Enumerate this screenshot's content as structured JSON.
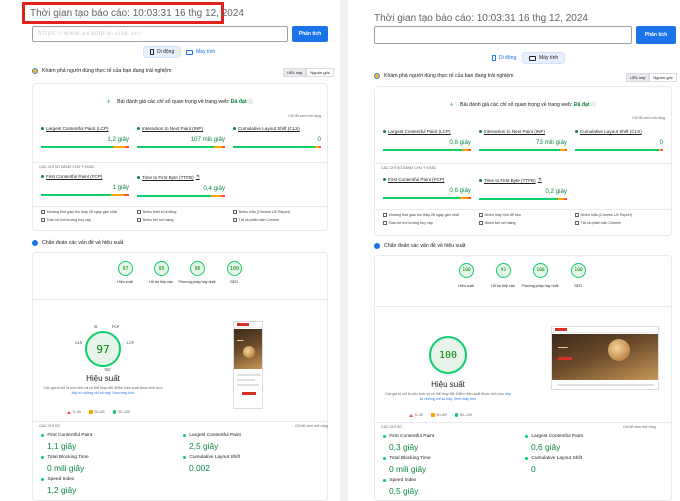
{
  "left": {
    "timestamp": "Thời gian tạo báo cáo: 10:03:31 16 thg 12, 2024",
    "url_value": "https://www.example-site.vn/",
    "analyze_label": "Phân tích",
    "tabs": {
      "mobile": "Di động",
      "desktop": "Máy tính"
    },
    "cwv": {
      "title": "Khám phá người dùng thực tế của bạn đang trải nghiệm",
      "toggle_url": "URL này",
      "toggle_origin": "Nguồn gốc",
      "assessment_prefix": "Bài đánh giá các chỉ số quan trọng về trang web:",
      "assessment_result": "Đã đạt",
      "more_info": "Chỉ đủ xem mở rộng",
      "metrics": [
        {
          "name": "Largest Contentful Paint (LCP)",
          "value": "1,2 giây"
        },
        {
          "name": "Interaction to Next Paint (INP)",
          "value": "107 mili giây"
        },
        {
          "name": "Cumulative Layout Shift (CLS)",
          "value": "0"
        }
      ],
      "other_heading": "CÁC CHỈ SỐ ĐÁNG CHÚ Ý KHÁC",
      "other_metrics": [
        {
          "name": "First Contentful Paint (FCP)",
          "value": "1 giây"
        },
        {
          "name": "Time to First Byte (TTFB)",
          "value": "0,4 giây"
        }
      ],
      "info": [
        "Khoảng thời gian thu thập 28 ngày gần nhất",
        "Nhiều thiết bị di động",
        "Nhiều mẫu (Chrome UX Report)",
        "Toàn bộ thời lượng truy cập",
        "Nhiều kết nối mạng",
        "Tất cả phiên bản Chrome"
      ],
      "info_link": "Chrome UX Report"
    },
    "diag": {
      "title": "Chẩn đoán các vấn đề về hiệu suất",
      "scores": [
        {
          "score": "97",
          "label": "Hiệu suất"
        },
        {
          "score": "95",
          "label": "Hỗ trợ tiếp cận"
        },
        {
          "score": "96",
          "label": "Phương pháp hay nhất"
        },
        {
          "score": "100",
          "label": "SEO"
        }
      ],
      "big_score": "97",
      "big_title": "Hiệu suất",
      "gauge_labels": {
        "si": "SI",
        "fcp": "FCP",
        "cls": "CLS",
        "lcp": "LCP",
        "tbt": "TBT"
      },
      "description_start": "Các giá trị chỉ là ước tính và có thể thay đổi. Điểm hiệu suất được tính trực",
      "description_link": "tiếp từ những chỉ số này.",
      "description_link2": "Xem máy tính",
      "legend": [
        "0–49",
        "50–89",
        "90–100"
      ],
      "metrics_heading": "CÁC CHỈ SỐ",
      "expand_label": "Chỉ đủ xem mở rộng",
      "metrics": [
        {
          "name": "First Contentful Paint",
          "value": "1,1 giây"
        },
        {
          "name": "Largest Contentful Paint",
          "value": "2,5 giây"
        },
        {
          "name": "Total Blocking Time",
          "value": "0 mili giây"
        },
        {
          "name": "Cumulative Layout Shift",
          "value": "0.002"
        },
        {
          "name": "Speed Index",
          "value": "1,2 giây"
        }
      ]
    }
  },
  "right": {
    "timestamp": "Thời gian tạo báo cáo: 10:03:31 16 thg 12, 2024",
    "url_value": "https://www.example-site.vn/",
    "analyze_label": "Phân tích",
    "tabs": {
      "mobile": "Di động",
      "desktop": "Máy tính"
    },
    "cwv": {
      "title": "Khám phá người dùng thực tế của bạn đang trải nghiệm",
      "toggle_url": "URL này",
      "toggle_origin": "Nguồn gốc",
      "assessment_prefix": "Bài đánh giá các chỉ số quan trọng về trang web:",
      "assessment_result": "Đã đạt",
      "more_info": "Chỉ đủ xem mở rộng",
      "metrics": [
        {
          "name": "Largest Contentful Paint (LCP)",
          "value": "0,8 giây"
        },
        {
          "name": "Interaction to Next Paint (INP)",
          "value": "73 mili giây"
        },
        {
          "name": "Cumulative Layout Shift (CLS)",
          "value": "0"
        }
      ],
      "other_heading": "CÁC CHỈ SỐ ĐÁNG CHÚ Ý KHÁC",
      "other_metrics": [
        {
          "name": "First Contentful Paint (FCP)",
          "value": "0,6 giây"
        },
        {
          "name": "Time to First Byte (TTFB)",
          "value": "0,2 giây"
        }
      ],
      "info": [
        "Khoảng thời gian thu thập 28 ngày gần nhất",
        "Nhiều máy tính để bàn",
        "Nhiều mẫu (Chrome UX Report)",
        "Toàn bộ thời lượng truy cập",
        "Nhiều kết nối mạng",
        "Tất cả phiên bản Chrome"
      ],
      "info_link": "Chrome UX Report"
    },
    "diag": {
      "title": "Chẩn đoán các vấn đề về hiệu suất",
      "scores": [
        {
          "score": "100",
          "label": "Hiệu suất"
        },
        {
          "score": "91",
          "label": "Hỗ trợ tiếp cận"
        },
        {
          "score": "100",
          "label": "Phương pháp hay nhất"
        },
        {
          "score": "100",
          "label": "SEO"
        }
      ],
      "big_score": "100",
      "big_title": "Hiệu suất",
      "description_start": "Các giá trị chỉ là ước tính và có thể thay đổi. Điểm hiệu suất được tính trực",
      "description_link": "tiếp từ những chỉ số này.",
      "description_link2": "Xem máy tính",
      "legend": [
        "0–49",
        "50–89",
        "90–100"
      ],
      "metrics_heading": "CÁC CHỈ SỐ",
      "expand_label": "Chỉ đủ xem mở rộng",
      "metrics": [
        {
          "name": "First Contentful Paint",
          "value": "0,3 giây"
        },
        {
          "name": "Largest Contentful Paint",
          "value": "0,6 giây"
        },
        {
          "name": "Total Blocking Time",
          "value": "0 mili giây"
        },
        {
          "name": "Cumulative Layout Shift",
          "value": "0"
        },
        {
          "name": "Speed Index",
          "value": "0,5 giây"
        }
      ]
    }
  },
  "colors": {
    "good": "#0cce6b",
    "average": "#ffa400",
    "poor": "#ff4e42",
    "accent": "#1a73e8",
    "highlight": "#e0231b"
  }
}
